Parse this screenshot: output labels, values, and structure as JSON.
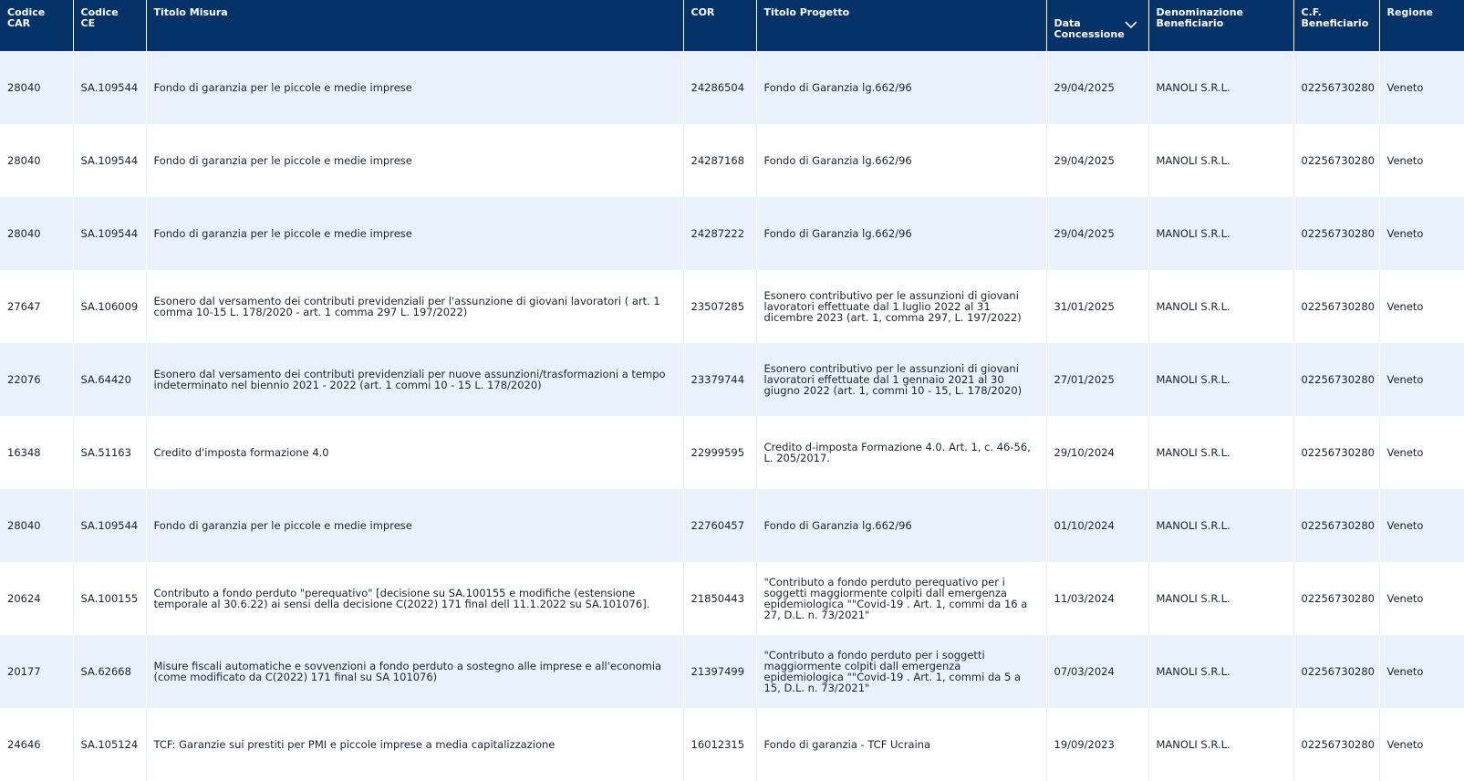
{
  "columns": [
    {
      "key": "car",
      "label": "Codice\nCAR"
    },
    {
      "key": "ce",
      "label": "Codice\nCE"
    },
    {
      "key": "misura",
      "label": "Titolo Misura"
    },
    {
      "key": "cor",
      "label": "COR"
    },
    {
      "key": "progetto",
      "label": "Titolo Progetto"
    },
    {
      "key": "data",
      "label": "Data\nConcessione"
    },
    {
      "key": "beneficiario",
      "label": "Denominazione\nBeneficiario"
    },
    {
      "key": "cf",
      "label": "C.F.\nBeneficiario"
    },
    {
      "key": "regione",
      "label": "Regione"
    }
  ],
  "sort": {
    "column": "data",
    "icon": "chevron-down-icon",
    "direction": "descending"
  },
  "rows": [
    {
      "car": "28040",
      "ce": "SA.109544",
      "misura": "Fondo di garanzia per le piccole e medie imprese",
      "cor": "24286504",
      "progetto": "Fondo di Garanzia lg.662/96",
      "data": "29/04/2025",
      "beneficiario": "MANOLI S.R.L.",
      "cf": "02256730280",
      "regione": "Veneto"
    },
    {
      "car": "28040",
      "ce": "SA.109544",
      "misura": "Fondo di garanzia per le piccole e medie imprese",
      "cor": "24287168",
      "progetto": "Fondo di Garanzia lg.662/96",
      "data": "29/04/2025",
      "beneficiario": "MANOLI S.R.L.",
      "cf": "02256730280",
      "regione": "Veneto"
    },
    {
      "car": "28040",
      "ce": "SA.109544",
      "misura": "Fondo di garanzia per le piccole e medie imprese",
      "cor": "24287222",
      "progetto": "Fondo di Garanzia lg.662/96",
      "data": "29/04/2025",
      "beneficiario": "MANOLI S.R.L.",
      "cf": "02256730280",
      "regione": "Veneto"
    },
    {
      "car": "27647",
      "ce": "SA.106009",
      "misura": "Esonero dal versamento dei contributi previdenziali per l'assunzione di giovani lavoratori ( art. 1 comma 10-15 L. 178/2020 - art. 1 comma 297 L. 197/2022)",
      "cor": "23507285",
      "progetto": "Esonero contributivo per le assunzioni di giovani lavoratori effettuate dal 1 luglio 2022 al 31 dicembre 2023 (art. 1, comma 297, L. 197/2022)",
      "data": "31/01/2025",
      "beneficiario": "MANOLI S.R.L.",
      "cf": "02256730280",
      "regione": "Veneto"
    },
    {
      "car": "22076",
      "ce": "SA.64420",
      "misura": "Esonero dal versamento dei contributi previdenziali per nuove assunzioni/trasformazioni a tempo indeterminato nel biennio 2021 - 2022 (art. 1 commi 10 - 15 L. 178/2020)",
      "cor": "23379744",
      "progetto": "Esonero contributivo per le assunzioni di giovani lavoratori effettuate dal 1 gennaio 2021 al 30 giugno 2022 (art. 1, commi 10 - 15, L. 178/2020)",
      "data": "27/01/2025",
      "beneficiario": "MANOLI S.R.L.",
      "cf": "02256730280",
      "regione": "Veneto"
    },
    {
      "car": "16348",
      "ce": "SA.51163",
      "misura": "Credito d'imposta formazione 4.0",
      "cor": "22999595",
      "progetto": "Credito d-imposta Formazione 4.0. Art. 1, c. 46-56, L. 205/2017.",
      "data": "29/10/2024",
      "beneficiario": "MANOLI S.R.L.",
      "cf": "02256730280",
      "regione": "Veneto"
    },
    {
      "car": "28040",
      "ce": "SA.109544",
      "misura": "Fondo di garanzia per le piccole e medie imprese",
      "cor": "22760457",
      "progetto": "Fondo di Garanzia lg.662/96",
      "data": "01/10/2024",
      "beneficiario": "MANOLI S.R.L.",
      "cf": "02256730280",
      "regione": "Veneto"
    },
    {
      "car": "20624",
      "ce": "SA.100155",
      "misura": "Contributo a fondo perduto \"perequativo\" [decisione su SA.100155 e modifiche (estensione temporale al 30.6.22) ai sensi della decisione C(2022) 171 final dell 11.1.2022 su SA.101076].",
      "cor": "21850443",
      "progetto": "\"Contributo a fondo perduto perequativo per i soggetti maggiormente colpiti dall emergenza epidemiologica \"\"Covid-19 . Art. 1, commi da 16 a 27, D.L. n. 73/2021\"",
      "data": "11/03/2024",
      "beneficiario": "MANOLI S.R.L.",
      "cf": "02256730280",
      "regione": "Veneto"
    },
    {
      "car": "20177",
      "ce": "SA.62668",
      "misura": "Misure fiscali automatiche e sovvenzioni a fondo perduto a sostegno alle imprese e all'economia (come modificato da C(2022) 171 final su SA 101076)",
      "cor": "21397499",
      "progetto": "\"Contributo a fondo perduto per i soggetti maggiormente colpiti dall emergenza epidemiologica \"\"Covid-19 . Art. 1, commi da 5 a 15, D.L. n. 73/2021\"",
      "data": "07/03/2024",
      "beneficiario": "MANOLI S.R.L.",
      "cf": "02256730280",
      "regione": "Veneto"
    },
    {
      "car": "24646",
      "ce": "SA.105124",
      "misura": "TCF: Garanzie sui prestiti per PMI e piccole imprese a media capitalizzazione",
      "cor": "16012315",
      "progetto": "Fondo di garanzia - TCF Ucraina",
      "data": "19/09/2023",
      "beneficiario": "MANOLI S.R.L.",
      "cf": "02256730280",
      "regione": "Veneto"
    }
  ],
  "colors": {
    "header_bg": "#06326a",
    "header_text": "#ffffff",
    "row_stripe": "#e8f1fc",
    "row_plain": "#ffffff"
  }
}
